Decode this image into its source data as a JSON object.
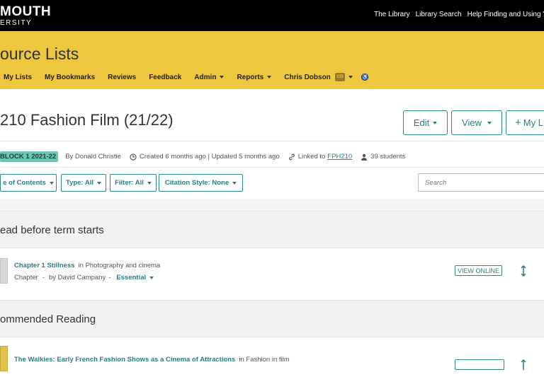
{
  "header": {
    "logo_main": "MOUTH",
    "logo_sub": "ERSITY",
    "links": [
      "The Library",
      "Library Search",
      "Help Finding and Using Y"
    ]
  },
  "app": {
    "title": "ource Lists"
  },
  "nav": {
    "items": [
      "My Lists",
      "My Bookmarks",
      "Reviews",
      "Feedback",
      "Admin",
      "Reports"
    ],
    "user": "Chris Dobson",
    "user_initials": "CD"
  },
  "list": {
    "title": "210 Fashion Film (21/22)",
    "buttons": {
      "edit": "Edit",
      "view": "View",
      "my": "My L"
    },
    "badge": "BLOCK 1 2021-22",
    "author": "By Donald Christie",
    "dates": "Created 6 months ago | Updated 5 months ago",
    "linked_label": "Linked to",
    "linked_value": "FPH210",
    "students": "39 students"
  },
  "filters": {
    "contents": "e of Contents",
    "type": "Type: All",
    "filter": "Filter: All",
    "citation": "Citation Style: None",
    "search_placeholder": "Search"
  },
  "sections": [
    {
      "heading": "ead before term starts",
      "items": [
        {
          "title": "Chapter 1 Stillness",
          "in": "in Photography and cinema",
          "type": "Chapter",
          "author": "by David Campany",
          "importance": "Essential",
          "action": "VIEW ONLINE"
        }
      ]
    },
    {
      "heading": "ommended Reading",
      "items": [
        {
          "title": "The Walkies: Early French Fashion Shows as a Cinema of Attractions",
          "in": "in Fashion in film"
        }
      ]
    }
  ],
  "colors": {
    "brand_yellow": "#ecc73f",
    "teal": "#2a7f7f",
    "badge": "#6cc6b0"
  }
}
